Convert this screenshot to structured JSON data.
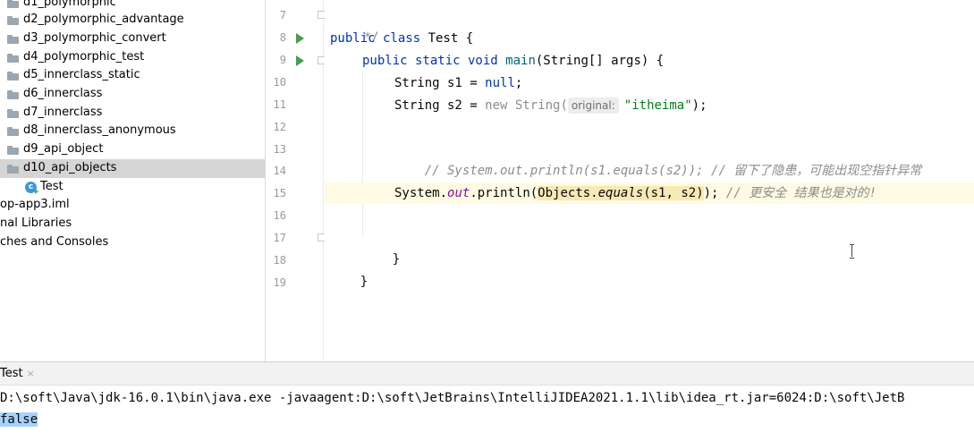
{
  "project_tree": {
    "items": [
      {
        "label": "d1_polymorphic",
        "kind": "folder"
      },
      {
        "label": "d2_polymorphic_advantage",
        "kind": "folder"
      },
      {
        "label": "d3_polymorphic_convert",
        "kind": "folder"
      },
      {
        "label": "d4_polymorphic_test",
        "kind": "folder"
      },
      {
        "label": "d5_innerclass_static",
        "kind": "folder"
      },
      {
        "label": "d6_innerclass",
        "kind": "folder"
      },
      {
        "label": "d7_innerclass",
        "kind": "folder"
      },
      {
        "label": "d8_innerclass_anonymous",
        "kind": "folder"
      },
      {
        "label": "d9_api_object",
        "kind": "folder"
      },
      {
        "label": "d10_api_objects",
        "kind": "folder",
        "selected": true
      },
      {
        "label": "Test",
        "kind": "class"
      },
      {
        "label": "op-app3.iml",
        "kind": "plain"
      },
      {
        "label": "nal Libraries",
        "kind": "plain"
      },
      {
        "label": "ches and Consoles",
        "kind": "plain"
      }
    ]
  },
  "editor": {
    "line_numbers": [
      "7",
      "8",
      "9",
      "10",
      "11",
      "12",
      "13",
      "14",
      "15",
      "16",
      "17",
      "18",
      "19"
    ],
    "lines": {
      "l7": "*/",
      "l8": {
        "kw1": "public class ",
        "rest": "Test {"
      },
      "l9": {
        "kw1": "public static void ",
        "fn": "main",
        "rest": "(String[] args) {"
      },
      "l10": {
        "pre": "String s1 = ",
        "kw": "null",
        "post": ";"
      },
      "l11": {
        "pre": "String s2 = ",
        "kw": "new String(",
        "hint": "original:",
        "str": "\"itheima\"",
        "post": ");"
      },
      "l13": "// System.out.println(s1.equals(s2)); // 留下了隐患，可能出现空指针异常",
      "l15": {
        "pre": "System.",
        "field": "out",
        "mid": ".println(",
        "hl_pre": "Objects.",
        "hl_fn": "equals",
        "hl_post": "(s1, s2)",
        "post": "); ",
        "cmt": "// 更安全 结果也是对的!"
      },
      "l17": "}",
      "l18": "}"
    }
  },
  "run_panel": {
    "tab_label": "Test",
    "tab_close": "×",
    "console_cmd": "D:\\soft\\Java\\jdk-16.0.1\\bin\\java.exe -javaagent:D:\\soft\\JetBrains\\IntelliJIDEA2021.1.1\\lib\\idea_rt.jar=6024:D:\\soft\\JetB",
    "console_output": "false"
  }
}
